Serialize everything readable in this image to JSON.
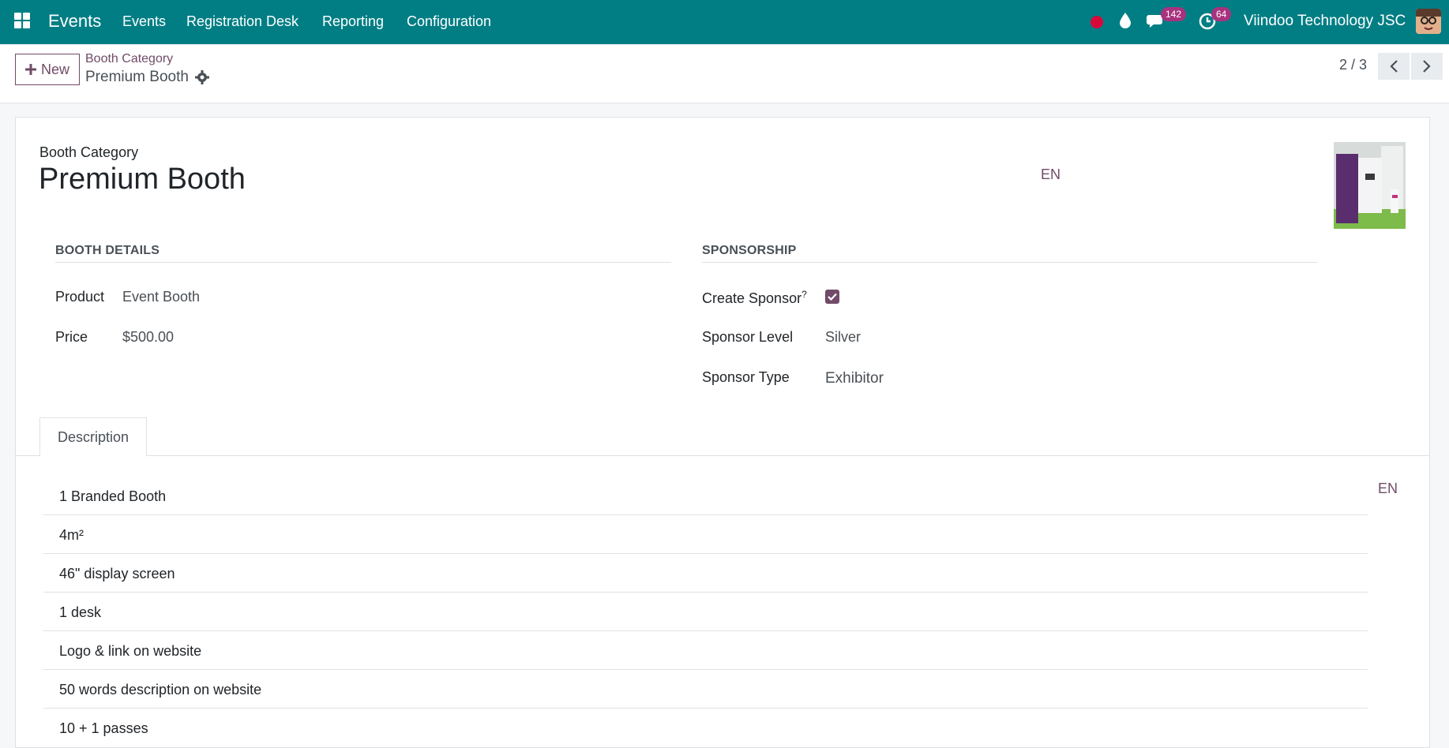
{
  "navbar": {
    "brand": "Events",
    "menu": [
      "Events",
      "Registration Desk",
      "Reporting",
      "Configuration"
    ],
    "messages_count": "142",
    "activities_count": "64",
    "company": "Viindoo Technology JSC",
    "icons": [
      "apps-icon",
      "record-dot-icon",
      "drop-icon",
      "chat-icon",
      "clock-icon"
    ]
  },
  "control": {
    "new_label": "New",
    "breadcrumb_parent": "Booth Category",
    "breadcrumb_current": "Premium Booth",
    "pager": "2 / 3"
  },
  "form": {
    "title_label": "Booth Category",
    "title": "Premium Booth",
    "title_lang": "EN",
    "booth_details": {
      "heading": "BOOTH DETAILS",
      "product_label": "Product",
      "product_value": "Event Booth",
      "price_label": "Price",
      "price_value": "$500.00"
    },
    "sponsorship": {
      "heading": "SPONSORSHIP",
      "create_sponsor_label": "Create Sponsor",
      "help_mark": "?",
      "create_sponsor_checked": true,
      "level_label": "Sponsor Level",
      "level_value": "Silver",
      "type_label": "Sponsor Type",
      "type_value": "Exhibitor"
    },
    "tab_label": "Description",
    "desc_lang": "EN",
    "description_rows": [
      "1 Branded Booth",
      "4m²",
      "46\" display screen",
      "1 desk",
      "Logo & link on website",
      "50 words description on website",
      "10 + 1 passes"
    ]
  },
  "colors": {
    "navbar": "#017e84",
    "accent": "#714b67",
    "badge": "#a8327e",
    "record_dot": "#d9083a"
  }
}
